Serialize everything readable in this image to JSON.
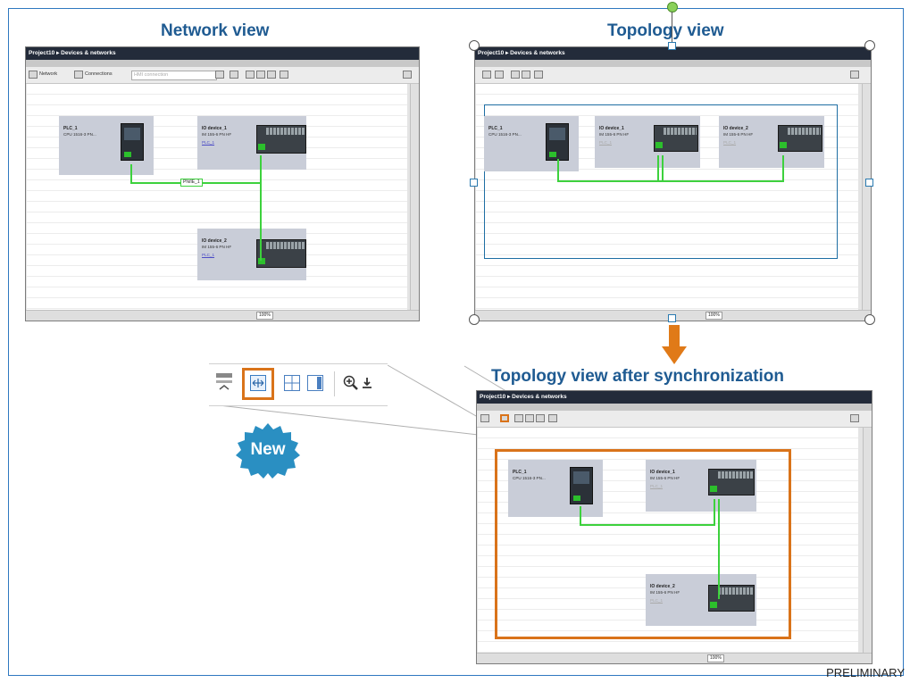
{
  "titles": {
    "network_view": "Network view",
    "topology_view": "Topology view",
    "topology_after_sync": "Topology view after synchronization"
  },
  "window": {
    "breadcrumb": "Project10 ▸ Devices & networks",
    "zoom": "100%"
  },
  "network_toolbar": {
    "network_tab": "Network",
    "connections_label": "Connections",
    "connection_type": "HMI connection"
  },
  "devices": {
    "plc": {
      "name": "PLC_1",
      "type": "CPU 1516-3 PN..."
    },
    "io1": {
      "name": "IO device_1",
      "type": "IM 155-6 PN HF",
      "link": "PLC_1"
    },
    "io2": {
      "name": "IO device_2",
      "type": "IM 155-6 PN HF",
      "link": "PLC_1"
    }
  },
  "subnet_label": "PN/IE_1",
  "badge": {
    "text": "New"
  },
  "footer": {
    "status": "PRELIMINARY"
  },
  "icons": [
    "network-icon",
    "connections-icon",
    "topology-sync-icon",
    "grid-icon",
    "table-icon",
    "zoom-in-icon",
    "download-arrow-icon"
  ],
  "colors": {
    "title_blue": "#1f5b92",
    "highlight_orange": "#d9731a",
    "badge_blue": "#2a8fc2",
    "wire_green": "#3dd13d",
    "frame_blue": "#2f78c0"
  }
}
